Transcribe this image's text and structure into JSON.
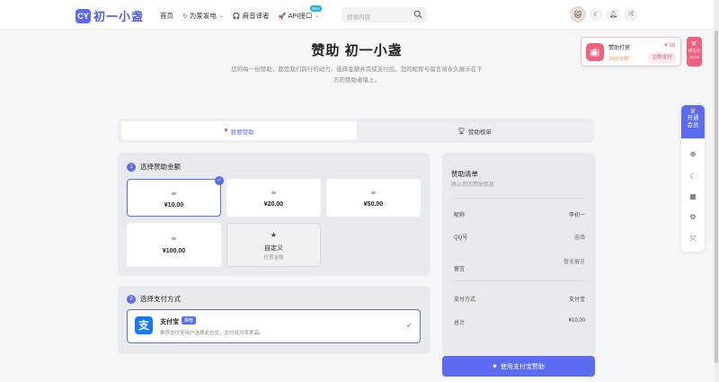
{
  "header": {
    "logo_mark": "CY",
    "logo_text": "初一小盏",
    "nav": [
      {
        "label": "首页",
        "icon": "",
        "has_chevron": false
      },
      {
        "label": "为爱发电",
        "icon": "↻",
        "has_chevron": true
      },
      {
        "label": "肩音译者",
        "icon": "🎧",
        "has_chevron": false
      },
      {
        "label": "API接口",
        "icon": "🚀",
        "has_chevron": true,
        "badge": "New"
      }
    ],
    "search_placeholder": "搜索内容"
  },
  "page": {
    "title": "赞助 初一小盏",
    "subtitle": "您的每一份赞助，都是我们前行的动力。选择金额并完成支付后，您的昵称与留言将永久展示在下方的赞助者墙上。"
  },
  "popup": {
    "title": "赞助打赏",
    "price": "¥ 10",
    "time": "24分16秒",
    "button": "立即支付",
    "side_label1": "待支付",
    "side_label2": "24:16"
  },
  "toolbar": {
    "vip_line1": "开通",
    "vip_line2": "会员"
  },
  "tabs": [
    {
      "label": "我要赞助",
      "icon": "heart-icon"
    },
    {
      "label": "赞助榜单",
      "icon": "trophy-icon"
    }
  ],
  "amount_section": {
    "step": "1",
    "title": "选择赞助金额",
    "amounts": [
      {
        "value": "¥10.00",
        "selected": true
      },
      {
        "value": "¥20.00",
        "selected": false
      },
      {
        "value": "¥50.00",
        "selected": false
      },
      {
        "value": "¥100.00",
        "selected": false
      }
    ],
    "custom": {
      "label": "自定义",
      "sub": "任意金额"
    }
  },
  "payment_section": {
    "step": "2",
    "title": "选择支付方式",
    "method": {
      "name": "支付宝",
      "tag": "推荐",
      "desc": "推荐支付宝用户选择此方式，支付成功率更高。",
      "logo": "支"
    }
  },
  "summary": {
    "title": "赞助清单",
    "subtitle": "确认您的赞助信息",
    "rows": [
      {
        "key": "昵称",
        "value": "李初一"
      },
      {
        "key": "QQ号",
        "value": "选填"
      },
      {
        "key": "留言",
        "value": "暂无留言"
      },
      {
        "key": "支付方式",
        "value": "支付宝"
      },
      {
        "key": "总计",
        "value": "¥10.00"
      }
    ],
    "button": "使用支付宝赞助"
  },
  "colors": {
    "accent": "#5b6cf0",
    "pink": "#f2607e"
  }
}
